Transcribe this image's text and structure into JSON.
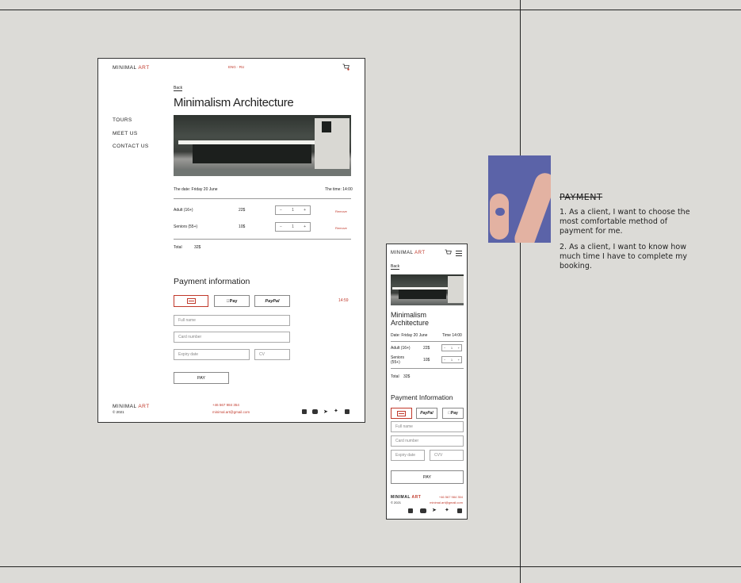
{
  "brand": {
    "word1": "MINIMAL",
    "word2": "ART",
    "copyright": "© 2021"
  },
  "lang": {
    "label": "ENG · RU"
  },
  "nav": {
    "items": [
      "TOURS",
      "MEET US",
      "CONTACT US"
    ]
  },
  "tour": {
    "back": "Back",
    "title": "Minimalism Architecture",
    "date": "The date: Friday 20 June",
    "time": "The time: 14:00",
    "tickets": [
      {
        "label": "Adult (16+)",
        "price": "22$",
        "qty": "1",
        "remove": "Remove"
      },
      {
        "label": "Seniors (55+)",
        "price": "10$",
        "qty": "1",
        "remove": "Remove"
      }
    ],
    "total_label": "Total",
    "total_value": "32$"
  },
  "payment": {
    "title": "Payment information",
    "timer": "14:59",
    "methods": {
      "applepay": " Pay",
      "paypal": "PayPal"
    },
    "full_name": "Full name",
    "card_number": "Card number",
    "expiry": "Expiry date",
    "cvv_desktop": "CV",
    "cvv_mobile": "CVV",
    "pay": "PAY"
  },
  "footer": {
    "phone": "+46 567 984 354",
    "email": "minimal.art@gmail.com"
  },
  "mobile": {
    "title_line1": "Minimalism",
    "title_line2": "Architecture",
    "date": "Date: Friday 20 June",
    "time": "Time 14:00",
    "adult": "Adult (16+)",
    "seniors_line1": "Seniors",
    "seniors_line2": "(55+)",
    "payment_title": "Payment Information"
  },
  "notes": {
    "heading": "PAYMENT",
    "item1": "1. As a client, I want to choose the most comfortable method of payment for me.",
    "item2": "2. As a client, I want to know how much time I have to complete my booking."
  },
  "colors": {
    "accent": "#c0392b",
    "swatch": "#5b63a8",
    "swatch_shape": "#e3b2a2",
    "background": "#dcdbd7"
  }
}
